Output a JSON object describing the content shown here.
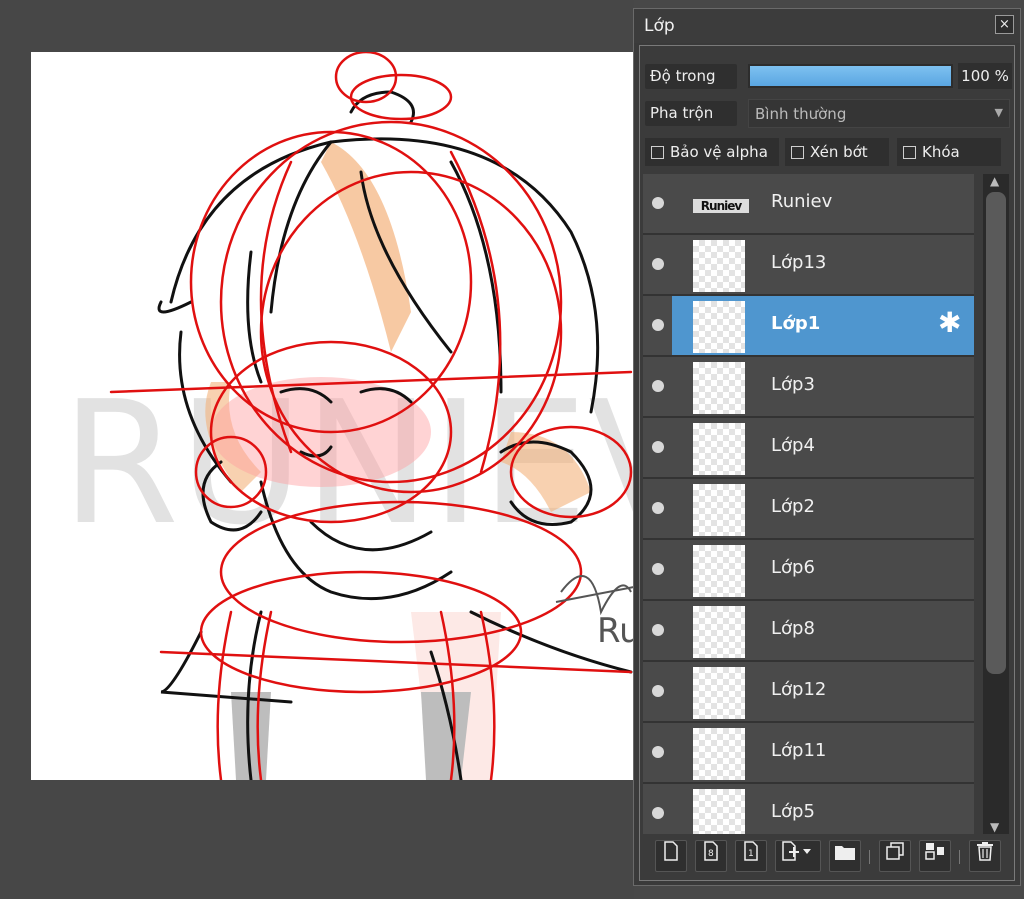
{
  "panel": {
    "title": "Lớp",
    "close_label": "×",
    "opacity_label": "Độ trong",
    "opacity_value": "100 %",
    "opacity_fraction": 1.0,
    "blend_label": "Pha trộn",
    "blend_value": "Bình thường",
    "checks": {
      "protect_alpha": "Bảo vệ alpha",
      "clip": "Xén bớt",
      "lock": "Khóa"
    }
  },
  "canvas": {
    "watermark": "RUNIEV",
    "signature": "Ru"
  },
  "layers": [
    {
      "name": "Runiev",
      "thumb": "Runiev",
      "selected": false
    },
    {
      "name": "Lớp13",
      "selected": false
    },
    {
      "name": "Lớp1",
      "selected": true
    },
    {
      "name": "Lớp3",
      "selected": false
    },
    {
      "name": "Lớp4",
      "selected": false
    },
    {
      "name": "Lớp2",
      "selected": false
    },
    {
      "name": "Lớp6",
      "selected": false
    },
    {
      "name": "Lớp8",
      "selected": false
    },
    {
      "name": "Lớp12",
      "selected": false
    },
    {
      "name": "Lớp11",
      "selected": false
    },
    {
      "name": "Lớp5",
      "selected": false
    }
  ],
  "toolbar_icons": [
    "new-layer-icon",
    "new-8bit-layer-icon",
    "new-1bit-layer-icon",
    "add-layer-dropdown-icon",
    "folder-icon",
    "duplicate-icon",
    "merge-icon",
    "trash-icon"
  ],
  "colors": {
    "accent": "#4f96cf",
    "opacity_fill": "#6ab2e8",
    "sketch_red": "#e01010",
    "panel_bg": "#3a3a3a"
  }
}
